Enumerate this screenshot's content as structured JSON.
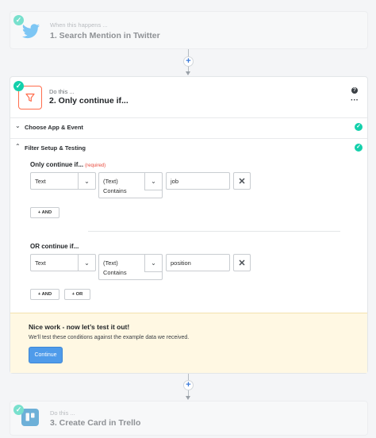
{
  "trigger_step": {
    "prefix": "When this happens ...",
    "title": "1. Search Mention in Twitter",
    "icon": "twitter-icon",
    "color": "#1da1f2"
  },
  "filter_step": {
    "prefix": "Do this ...",
    "title": "2. Only continue if...",
    "icon": "filter-icon",
    "accent": "#ff6d4c"
  },
  "sections": {
    "choose_app": "Choose App & Event",
    "filter_setup": "Filter Setup & Testing"
  },
  "groups": [
    {
      "label": "Only continue if...",
      "required": "(required)",
      "field": "Text",
      "condition_line1": "(Text)",
      "condition_line2": "Contains",
      "value": "job",
      "buttons": [
        "+ AND"
      ]
    },
    {
      "label": "OR continue if...",
      "field": "Text",
      "condition_line1": "(Text)",
      "condition_line2": "Contains",
      "value": "position",
      "buttons": [
        "+ AND",
        "+ OR"
      ]
    }
  ],
  "notice": {
    "title": "Nice work - now let’s test it out!",
    "text": "We’ll test these conditions against the example data we received.",
    "button": "Continue"
  },
  "action_step": {
    "prefix": "Do this ...",
    "title": "3. Create Card in Trello",
    "icon": "trello-icon",
    "color": "#0079bf"
  },
  "add_step_symbol": "+",
  "colors": {
    "success": "#13d0ab",
    "primary": "#4f9bea",
    "notice_bg": "#fff8e3"
  }
}
